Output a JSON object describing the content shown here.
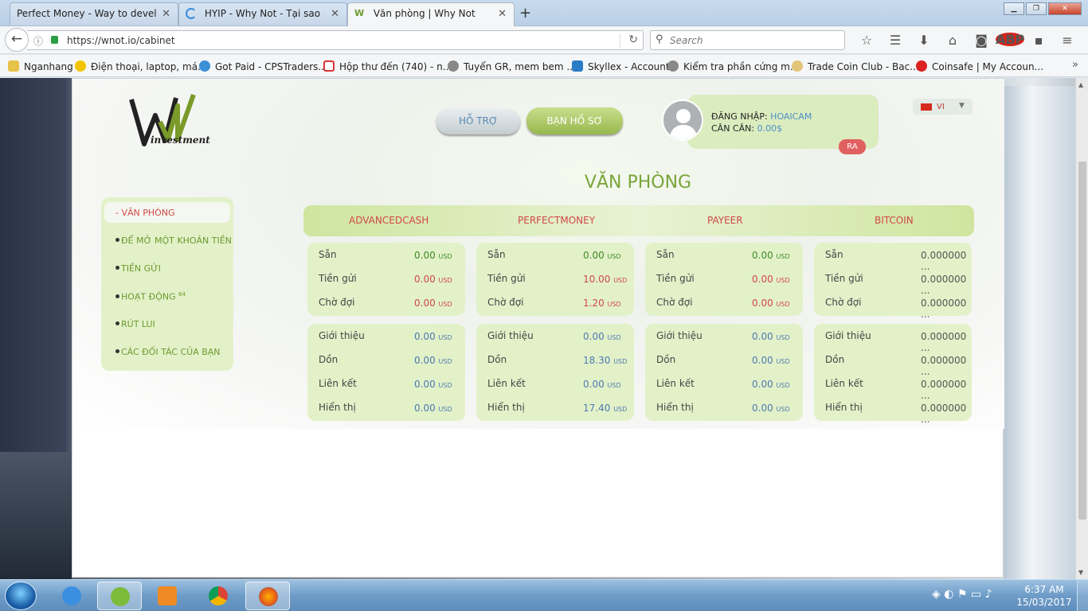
{
  "browser": {
    "tabs": [
      {
        "title": "Perfect Money - Way to develo..."
      },
      {
        "title": "HYIP - Why Not - Tại sao k..."
      },
      {
        "title": "Văn phòng | Why Not"
      }
    ],
    "url": "https://wnot.io/cabinet",
    "search_placeholder": "Search",
    "bookmarks": [
      {
        "label": "Nganhang"
      },
      {
        "label": "Điện thoại, laptop, má..."
      },
      {
        "label": "Got Paid - CPSTraders..."
      },
      {
        "label": "Hộp thư đến (740) - n..."
      },
      {
        "label": "Tuyển GR, mem bem ..."
      },
      {
        "label": "Skyllex - Account"
      },
      {
        "label": "Kiểm tra phần cứng m..."
      },
      {
        "label": "Trade Coin Club - Bac..."
      },
      {
        "label": "Coinsafe | My Accoun..."
      }
    ],
    "more_symbol": "»",
    "abp_label": "ABP"
  },
  "site": {
    "logo_text": "investment",
    "support_button": "HỖ TRỢ",
    "profile_button": "BẠN HỒ SƠ",
    "login_label": "ĐĂNG NHẬP:",
    "login_user": "HOAICAM",
    "balance_label": "CÂN CÂN:",
    "balance_value": "0.00$",
    "logout_button": "RA",
    "language": "VI",
    "page_title": "VĂN PHÒNG",
    "sidebar": [
      {
        "label": "- VĂN PHÒNG"
      },
      {
        "label": "ĐỂ MỞ MỘT KHOẢN TIỀN"
      },
      {
        "label": "TIỀN GỬI"
      },
      {
        "label": "HOẠT ĐỘNG",
        "badge": "64"
      },
      {
        "label": "RÚT LUI"
      },
      {
        "label": "CÁC ĐỐI TÁC CỦA BẠN"
      }
    ],
    "payment_systems": [
      "ADVANCEDCASH",
      "PERFECTMONEY",
      "PAYEER",
      "BITCOIN"
    ],
    "unit": "USD",
    "top_cards": [
      {
        "rows": [
          {
            "label": "Sẵn",
            "value": "0.00",
            "unit": "USD"
          },
          {
            "label": "Tiền gửi",
            "value": "0.00",
            "unit": "USD"
          },
          {
            "label": "Chờ đợi",
            "value": "0.00",
            "unit": "USD"
          }
        ]
      },
      {
        "rows": [
          {
            "label": "Sẵn",
            "value": "0.00",
            "unit": "USD"
          },
          {
            "label": "Tiền gửi",
            "value": "10.00",
            "unit": "USD"
          },
          {
            "label": "Chờ đợi",
            "value": "1.20",
            "unit": "USD"
          }
        ]
      },
      {
        "rows": [
          {
            "label": "Sẵn",
            "value": "0.00",
            "unit": "USD"
          },
          {
            "label": "Tiền gửi",
            "value": "0.00",
            "unit": "USD"
          },
          {
            "label": "Chờ đợi",
            "value": "0.00",
            "unit": "USD"
          }
        ]
      },
      {
        "rows": [
          {
            "label": "Sẵn",
            "value": "0.000000 ...",
            "unit": ""
          },
          {
            "label": "Tiền gửi",
            "value": "0.000000 ...",
            "unit": ""
          },
          {
            "label": "Chờ đợi",
            "value": "0.000000 ...",
            "unit": ""
          }
        ]
      }
    ],
    "bottom_cards": [
      {
        "rows": [
          {
            "label": "Giới thiệu",
            "value": "0.00",
            "unit": "USD"
          },
          {
            "label": "Dồn",
            "value": "0.00",
            "unit": "USD"
          },
          {
            "label": "Liên kết",
            "value": "0.00",
            "unit": "USD"
          },
          {
            "label": "Hiển thị",
            "value": "0.00",
            "unit": "USD"
          }
        ]
      },
      {
        "rows": [
          {
            "label": "Giới thiệu",
            "value": "0.00",
            "unit": "USD"
          },
          {
            "label": "Dồn",
            "value": "18.30",
            "unit": "USD"
          },
          {
            "label": "Liên kết",
            "value": "0.00",
            "unit": "USD"
          },
          {
            "label": "Hiển thị",
            "value": "17.40",
            "unit": "USD"
          }
        ]
      },
      {
        "rows": [
          {
            "label": "Giới thiệu",
            "value": "0.00",
            "unit": "USD"
          },
          {
            "label": "Dồn",
            "value": "0.00",
            "unit": "USD"
          },
          {
            "label": "Liên kết",
            "value": "0.00",
            "unit": "USD"
          },
          {
            "label": "Hiển thị",
            "value": "0.00",
            "unit": "USD"
          }
        ]
      },
      {
        "rows": [
          {
            "label": "Giới thiệu",
            "value": "0.000000 ...",
            "unit": ""
          },
          {
            "label": "Dồn",
            "value": "0.000000 ...",
            "unit": ""
          },
          {
            "label": "Liên kết",
            "value": "0.000000 ...",
            "unit": ""
          },
          {
            "label": "Hiển thị",
            "value": "0.000000 ...",
            "unit": ""
          }
        ]
      }
    ]
  },
  "taskbar": {
    "time": "6:37 AM",
    "date": "15/03/2017",
    "apps": [
      "internet-explorer",
      "coc-coc",
      "media-player",
      "chrome",
      "firefox"
    ]
  }
}
